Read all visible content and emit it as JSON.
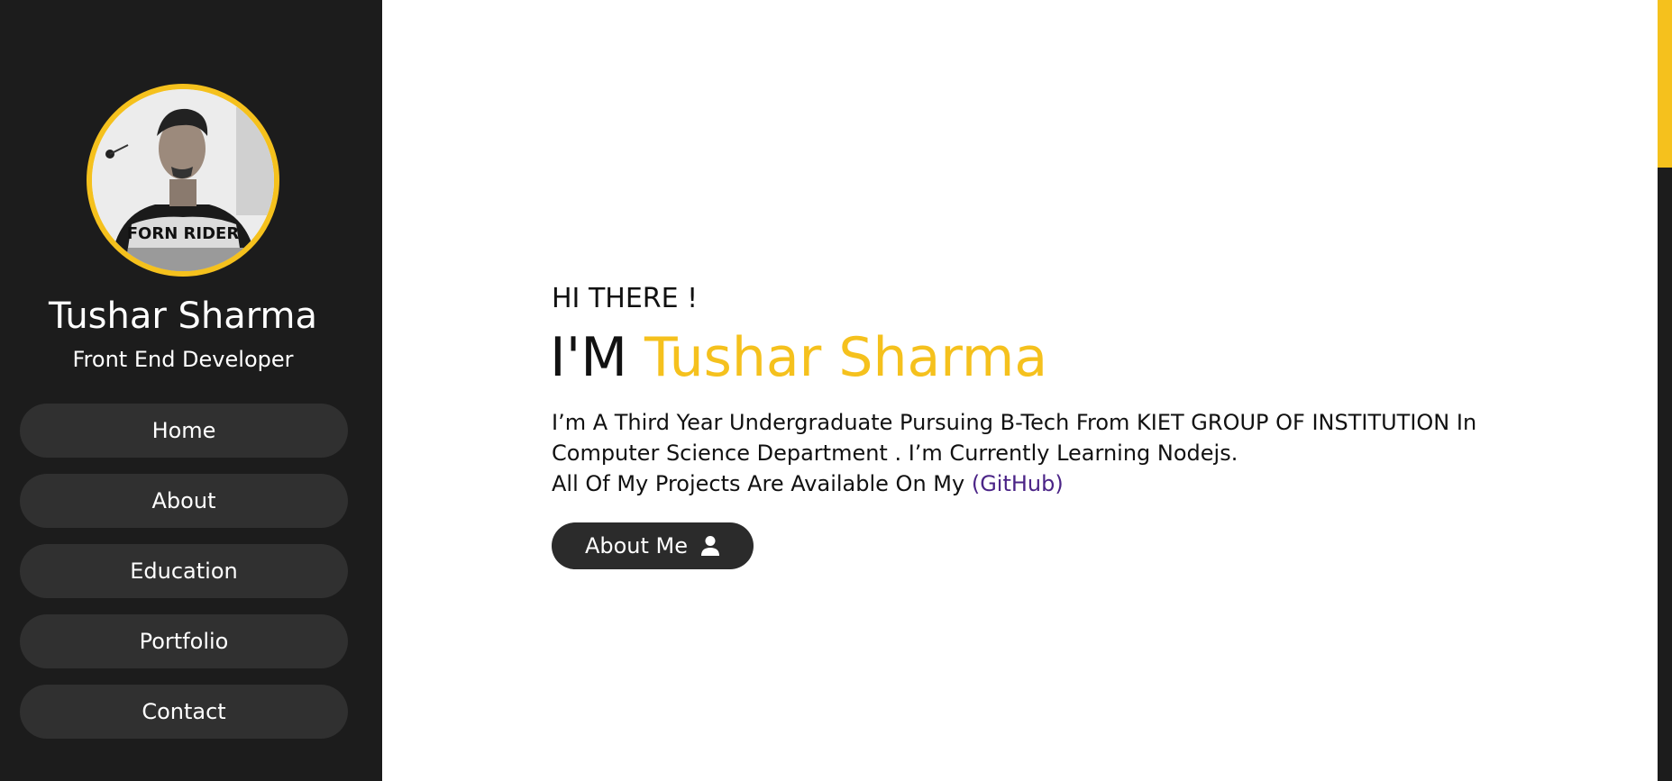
{
  "sidebar": {
    "profile": {
      "name": "Tushar Sharma",
      "role": "Front End Developer",
      "shirt_text": "FORN RIDER"
    },
    "nav": [
      {
        "label": "Home"
      },
      {
        "label": "About"
      },
      {
        "label": "Education"
      },
      {
        "label": "Portfolio"
      },
      {
        "label": "Contact"
      }
    ]
  },
  "hero": {
    "greeting": "HI THERE !",
    "headline_prefix": "I'M ",
    "headline_name": "Tushar Sharma",
    "bio_line1": "I’m A Third Year Undergraduate Pursuing B-Tech From KIET GROUP OF INSTITUTION In Computer Science Department . I’m Currently Learning Nodejs.",
    "bio_line2": "All Of My Projects Are Available On My ",
    "github_link": "(GitHub)",
    "about_button": "About Me",
    "about_icon": "user-icon"
  },
  "scrollbar": {
    "position": 0
  },
  "colors": {
    "accent": "#f5c11d",
    "sidebar_bg": "#1c1c1c",
    "nav_item_bg": "#303030",
    "link": "#4b2487",
    "text": "#111111"
  }
}
